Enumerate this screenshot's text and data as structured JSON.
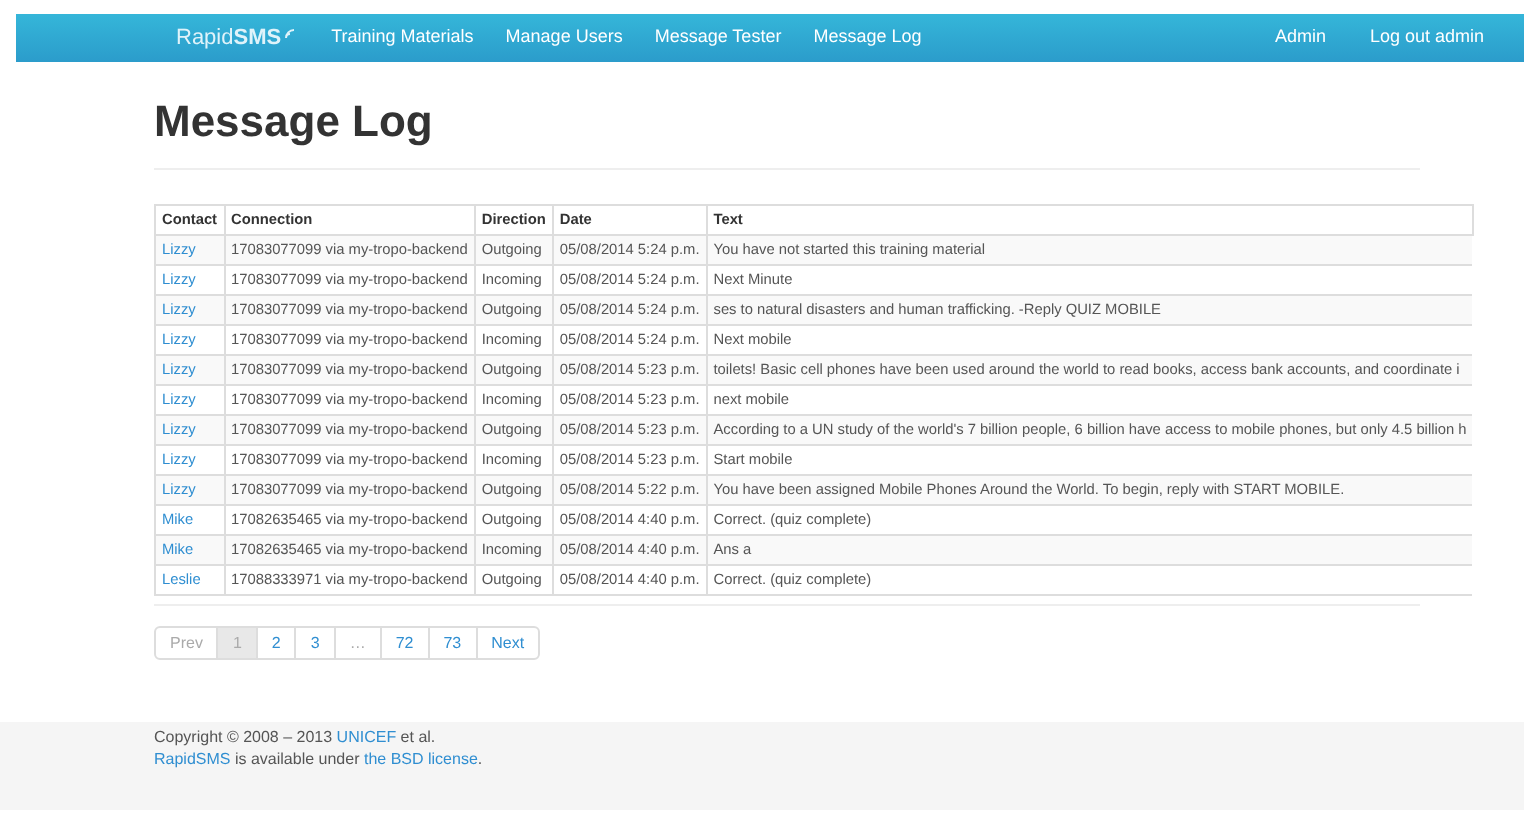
{
  "navbar": {
    "brand": "Rapid**SMS**",
    "links": [
      {
        "label": "Training Materials"
      },
      {
        "label": "Manage Users"
      },
      {
        "label": "Message Tester"
      },
      {
        "label": "Message Log"
      }
    ],
    "right_links": [
      {
        "label": "Admin"
      },
      {
        "label": "Log out admin"
      }
    ]
  },
  "page_title": "Message Log",
  "table": {
    "columns": [
      "Contact",
      "Connection",
      "Direction",
      "Date",
      "Text"
    ],
    "rows": [
      {
        "contact": "Lizzy",
        "connection": "17083077099 via my-tropo-backend",
        "direction": "Outgoing",
        "date": "05/08/2014 5:24 p.m.",
        "text": "You have not started this training material"
      },
      {
        "contact": "Lizzy",
        "connection": "17083077099 via my-tropo-backend",
        "direction": "Incoming",
        "date": "05/08/2014 5:24 p.m.",
        "text": "Next Minute"
      },
      {
        "contact": "Lizzy",
        "connection": "17083077099 via my-tropo-backend",
        "direction": "Outgoing",
        "date": "05/08/2014 5:24 p.m.",
        "text": "ses to natural disasters and human trafficking. -Reply QUIZ MOBILE"
      },
      {
        "contact": "Lizzy",
        "connection": "17083077099 via my-tropo-backend",
        "direction": "Incoming",
        "date": "05/08/2014 5:24 p.m.",
        "text": "Next mobile"
      },
      {
        "contact": "Lizzy",
        "connection": "17083077099 via my-tropo-backend",
        "direction": "Outgoing",
        "date": "05/08/2014 5:23 p.m.",
        "text": "toilets! Basic cell phones have been used around the world to read books, access bank accounts, and coordinate i"
      },
      {
        "contact": "Lizzy",
        "connection": "17083077099 via my-tropo-backend",
        "direction": "Incoming",
        "date": "05/08/2014 5:23 p.m.",
        "text": "next mobile"
      },
      {
        "contact": "Lizzy",
        "connection": "17083077099 via my-tropo-backend",
        "direction": "Outgoing",
        "date": "05/08/2014 5:23 p.m.",
        "text": "According to a UN study of the world's 7 billion people, 6 billion have access to mobile phones, but only 4.5 billion h"
      },
      {
        "contact": "Lizzy",
        "connection": "17083077099 via my-tropo-backend",
        "direction": "Incoming",
        "date": "05/08/2014 5:23 p.m.",
        "text": "Start mobile"
      },
      {
        "contact": "Lizzy",
        "connection": "17083077099 via my-tropo-backend",
        "direction": "Outgoing",
        "date": "05/08/2014 5:22 p.m.",
        "text": "You have been assigned Mobile Phones Around the World. To begin, reply with START MOBILE."
      },
      {
        "contact": "Mike",
        "connection": "17082635465 via my-tropo-backend",
        "direction": "Outgoing",
        "date": "05/08/2014 4:40 p.m.",
        "text": "Correct. (quiz complete)"
      },
      {
        "contact": "Mike",
        "connection": "17082635465 via my-tropo-backend",
        "direction": "Incoming",
        "date": "05/08/2014 4:40 p.m.",
        "text": "Ans a"
      },
      {
        "contact": "Leslie",
        "connection": "17088333971 via my-tropo-backend",
        "direction": "Outgoing",
        "date": "05/08/2014 4:40 p.m.",
        "text": "Correct. (quiz complete)"
      }
    ]
  },
  "pagination": [
    {
      "label": "Prev",
      "selected": false,
      "disabled": true
    },
    {
      "label": "1",
      "selected": true,
      "disabled": true
    },
    {
      "label": "2",
      "selected": false,
      "disabled": false
    },
    {
      "label": "3",
      "selected": false,
      "disabled": false
    },
    {
      "label": "…",
      "selected": false,
      "disabled": true
    },
    {
      "label": "72",
      "selected": false,
      "disabled": false
    },
    {
      "label": "73",
      "selected": false,
      "disabled": false
    },
    {
      "label": "Next",
      "selected": false,
      "disabled": false
    }
  ],
  "footer": [
    [
      {
        "text": "Copyright © 2008 – 2013 ",
        "kind": "text"
      },
      {
        "text": "UNICEF",
        "kind": "link"
      },
      {
        "text": " et al.",
        "kind": "text"
      }
    ],
    [
      {
        "text": "RapidSMS",
        "kind": "link"
      },
      {
        "text": " is available under ",
        "kind": "text"
      },
      {
        "text": "the BSD license",
        "kind": "link"
      },
      {
        "text": ".",
        "kind": "text"
      }
    ]
  ]
}
